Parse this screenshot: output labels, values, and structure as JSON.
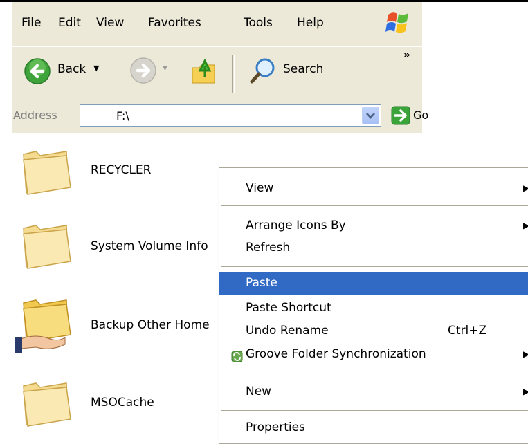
{
  "menubar": {
    "items": [
      "File",
      "Edit",
      "View",
      "Favorites",
      "Tools",
      "Help"
    ]
  },
  "toolbar": {
    "back_label": "Back",
    "search_label": "Search",
    "overflow": "»"
  },
  "address": {
    "label": "Address",
    "value": "F:\\",
    "go_label": "Go"
  },
  "folders": [
    {
      "name": "RECYCLER",
      "icon": "folder-icon"
    },
    {
      "name": "System Volume Info",
      "icon": "folder-icon"
    },
    {
      "name": "Backup Other Home",
      "icon": "shared-folder-icon"
    },
    {
      "name": "MSOCache",
      "icon": "folder-icon"
    }
  ],
  "context_menu": {
    "view": "View",
    "arrange": "Arrange Icons By",
    "refresh": "Refresh",
    "paste": "Paste",
    "paste_shortcut": "Paste Shortcut",
    "undo_rename": "Undo Rename",
    "undo_shortcut": "Ctrl+Z",
    "groove": "Groove Folder Synchronization",
    "new": "New",
    "properties": "Properties"
  },
  "colors": {
    "highlight": "#316ac5",
    "chrome": "#ece9d8"
  }
}
